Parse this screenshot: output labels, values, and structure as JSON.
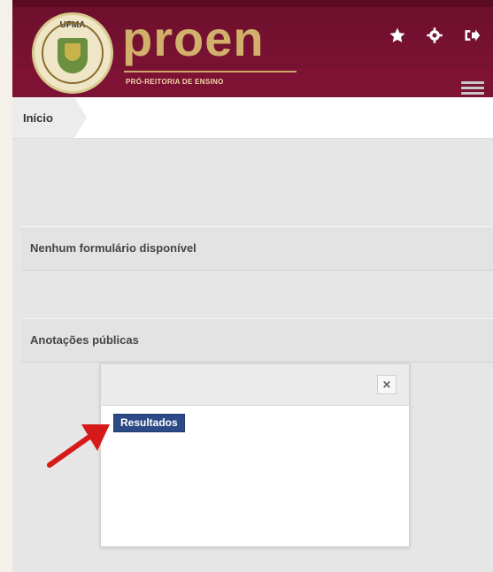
{
  "header": {
    "logo_text": "UFMA",
    "brand_title": "proen",
    "brand_subtitle": "PRÓ-REITORIA DE ENSINO",
    "colors": {
      "primary": "#7a1233",
      "gold": "#d1b06b"
    },
    "icons": [
      "star-icon",
      "gear-icon",
      "sign-out-icon",
      "menu-icon"
    ]
  },
  "breadcrumb": {
    "current": "Início"
  },
  "panels": [
    {
      "title": "Nenhum formulário disponível"
    },
    {
      "title": "Anotações públicas"
    }
  ],
  "modal": {
    "close_label": "×",
    "result_button": "Resultados"
  }
}
